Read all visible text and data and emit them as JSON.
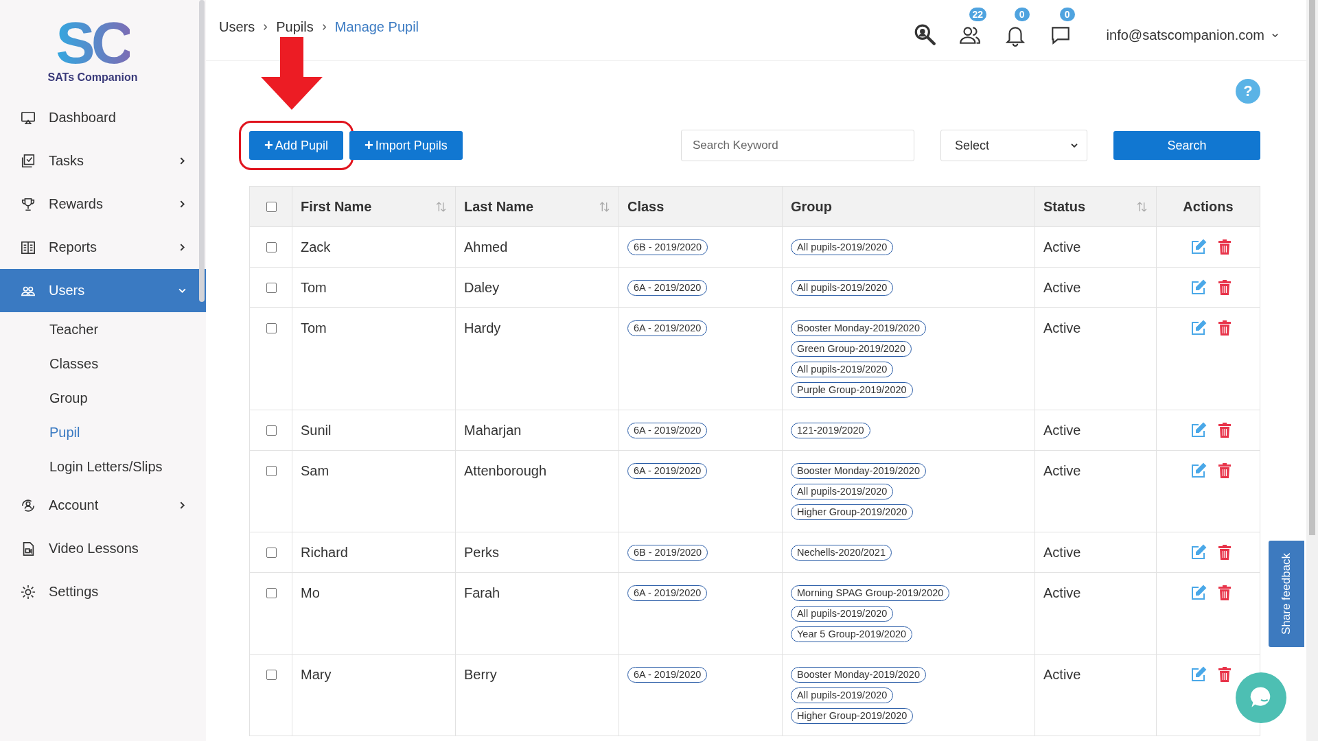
{
  "sidebar": {
    "logo_mark": "SC",
    "logo_text": "SATs Companion",
    "items": [
      {
        "label": "Dashboard",
        "kind": "monitor",
        "has_submenu": false,
        "selected": false
      },
      {
        "label": "Tasks",
        "kind": "tasks",
        "has_submenu": true,
        "selected": false,
        "expanded": false
      },
      {
        "label": "Rewards",
        "kind": "trophy",
        "has_submenu": true,
        "selected": false,
        "expanded": false
      },
      {
        "label": "Reports",
        "kind": "reports",
        "has_submenu": true,
        "selected": false,
        "expanded": false
      },
      {
        "label": "Users",
        "kind": "users",
        "has_submenu": true,
        "selected": true,
        "expanded": true,
        "children": [
          {
            "label": "Teacher",
            "selected": false
          },
          {
            "label": "Classes",
            "selected": false
          },
          {
            "label": "Group",
            "selected": false
          },
          {
            "label": "Pupil",
            "selected": true
          },
          {
            "label": "Login Letters/Slips",
            "selected": false
          }
        ]
      },
      {
        "label": "Account",
        "kind": "account",
        "has_submenu": true,
        "selected": false,
        "expanded": false
      },
      {
        "label": "Video Lessons",
        "kind": "video",
        "has_submenu": false,
        "selected": false
      },
      {
        "label": "Settings",
        "kind": "settings",
        "has_submenu": false,
        "selected": false
      }
    ]
  },
  "breadcrumb": [
    {
      "label": "Users",
      "current": false
    },
    {
      "label": "Pupils",
      "current": false
    },
    {
      "label": "Manage Pupil",
      "current": true
    }
  ],
  "header": {
    "users_badge": "22",
    "notifications_badge": "0",
    "messages_badge": "0",
    "account": "info@satscompanion.com"
  },
  "help": "?",
  "toolbar": {
    "buttons": [
      {
        "icon": "+",
        "label": "Add Pupil",
        "highlighted": true
      },
      {
        "icon": "+",
        "label": "Import Pupils",
        "highlighted": false
      }
    ],
    "search": {
      "placeholder": "Search Keyword"
    },
    "select": {
      "value": "Select"
    },
    "search_button": "Search"
  },
  "table": {
    "select_all_checked": false,
    "columns": [
      {
        "label": "First Name",
        "sortable": true
      },
      {
        "label": "Last Name",
        "sortable": true
      },
      {
        "label": "Class",
        "sortable": false
      },
      {
        "label": "Group",
        "sortable": false
      },
      {
        "label": "Status",
        "sortable": true
      },
      {
        "label": "Actions",
        "sortable": false
      }
    ],
    "rows": [
      {
        "checked": false,
        "first_name": "Zack",
        "last_name": "Ahmed",
        "class": "6B - 2019/2020",
        "groups": [
          "All pupils-2019/2020"
        ],
        "status": "Active"
      },
      {
        "checked": false,
        "first_name": "Tom",
        "last_name": "Daley",
        "class": "6A - 2019/2020",
        "groups": [
          "All pupils-2019/2020"
        ],
        "status": "Active"
      },
      {
        "checked": false,
        "first_name": "Tom",
        "last_name": "Hardy",
        "class": "6A - 2019/2020",
        "groups": [
          "Booster Monday-2019/2020",
          "Green Group-2019/2020",
          "All pupils-2019/2020",
          "Purple Group-2019/2020"
        ],
        "status": "Active"
      },
      {
        "checked": false,
        "first_name": "Sunil",
        "last_name": "Maharjan",
        "class": "6A - 2019/2020",
        "groups": [
          "121-2019/2020"
        ],
        "status": "Active"
      },
      {
        "checked": false,
        "first_name": "Sam",
        "last_name": "Attenborough",
        "class": "6A - 2019/2020",
        "groups": [
          "Booster Monday-2019/2020",
          "All pupils-2019/2020",
          "Higher Group-2019/2020"
        ],
        "status": "Active"
      },
      {
        "checked": false,
        "first_name": "Richard",
        "last_name": "Perks",
        "class": "6B - 2019/2020",
        "groups": [
          "Nechells-2020/2021"
        ],
        "status": "Active"
      },
      {
        "checked": false,
        "first_name": "Mo",
        "last_name": "Farah",
        "class": "6A - 2019/2020",
        "groups": [
          "Morning SPAG Group-2019/2020",
          "All pupils-2019/2020",
          "Year 5 Group-2019/2020"
        ],
        "status": "Active"
      },
      {
        "checked": false,
        "first_name": "Mary",
        "last_name": "Berry",
        "class": "6A - 2019/2020",
        "groups": [
          "Booster Monday-2019/2020",
          "All pupils-2019/2020",
          "Higher Group-2019/2020"
        ],
        "status": "Active"
      }
    ]
  },
  "feedback": "Share feedback"
}
